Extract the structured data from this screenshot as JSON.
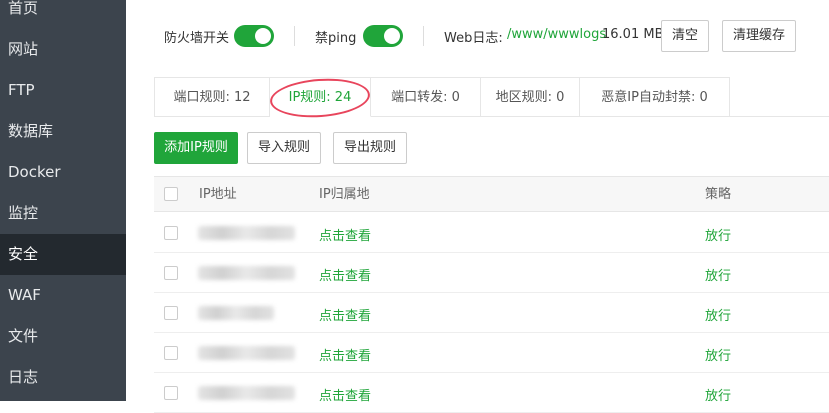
{
  "sidebar": {
    "items": [
      {
        "label": "首页"
      },
      {
        "label": "网站"
      },
      {
        "label": "FTP"
      },
      {
        "label": "数据库"
      },
      {
        "label": "Docker"
      },
      {
        "label": "监控"
      },
      {
        "label": "安全",
        "active": true
      },
      {
        "label": "WAF"
      },
      {
        "label": "文件"
      },
      {
        "label": "日志"
      }
    ]
  },
  "topbar": {
    "firewall_label": "防火墙开关",
    "firewall_on": true,
    "ping_label": "禁ping",
    "ping_on": true,
    "weblog_label": "Web日志:",
    "weblog_path": "/www/wwwlogs",
    "weblog_size": "16.01 MB",
    "clear_button": "清空",
    "clear_cache_button": "清理缓存"
  },
  "tabs": [
    {
      "label": "端口规则: 12"
    },
    {
      "label": "IP规则: 24",
      "active": true
    },
    {
      "label": "端口转发: 0"
    },
    {
      "label": "地区规则: 0"
    },
    {
      "label": "恶意IP自动封禁: 0"
    }
  ],
  "actions": {
    "add_ip_rule": "添加IP规则",
    "import_rules": "导入规则",
    "export_rules": "导出规则"
  },
  "table": {
    "columns": [
      "IP地址",
      "IP归属地",
      "策略"
    ],
    "rows": [
      {
        "location": "点击查看",
        "policy": "放行"
      },
      {
        "location": "点击查看",
        "policy": "放行"
      },
      {
        "location": "点击查看",
        "policy": "放行"
      },
      {
        "location": "点击查看",
        "policy": "放行"
      },
      {
        "location": "点击查看",
        "policy": "放行"
      }
    ]
  },
  "colors": {
    "accent": "#20a53a",
    "sidebar_bg": "#3c444d",
    "sidebar_active": "#23292f",
    "highlight_circle": "#e8455c"
  }
}
